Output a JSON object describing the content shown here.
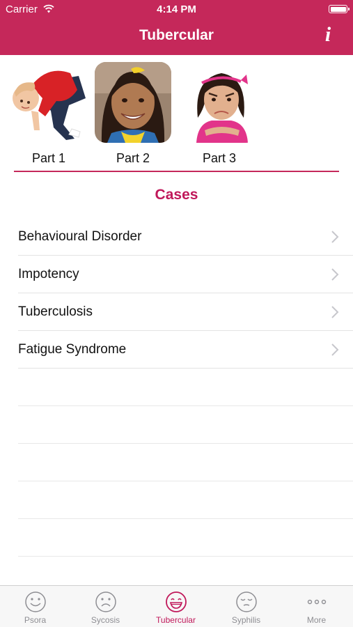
{
  "status_bar": {
    "carrier": "Carrier",
    "time": "4:14 PM",
    "icons": [
      "wifi-icon",
      "battery-icon"
    ]
  },
  "nav": {
    "title": "Tubercular",
    "info_icon": "info-icon",
    "color": "#c5285a"
  },
  "parts": [
    {
      "label": "Part 1",
      "image": "toddler-in-red-shirt-photo"
    },
    {
      "label": "Part 2",
      "image": "smiling-girl-photo"
    },
    {
      "label": "Part 3",
      "image": "frowning-girl-photo"
    }
  ],
  "cases": {
    "title": "Cases",
    "accent": "#c0185a",
    "items": [
      {
        "label": "Behavioural Disorder"
      },
      {
        "label": "Impotency"
      },
      {
        "label": "Tuberculosis"
      },
      {
        "label": "Fatigue Syndrome"
      }
    ]
  },
  "tab_bar": {
    "selected": "Tubercular",
    "tabs": [
      {
        "label": "Psora",
        "icon": "smiley-face-icon"
      },
      {
        "label": "Sycosis",
        "icon": "sad-face-icon"
      },
      {
        "label": "Tubercular",
        "icon": "grinning-face-icon"
      },
      {
        "label": "Syphilis",
        "icon": "sleepy-face-icon"
      },
      {
        "label": "More",
        "icon": "more-dots-icon"
      }
    ]
  }
}
